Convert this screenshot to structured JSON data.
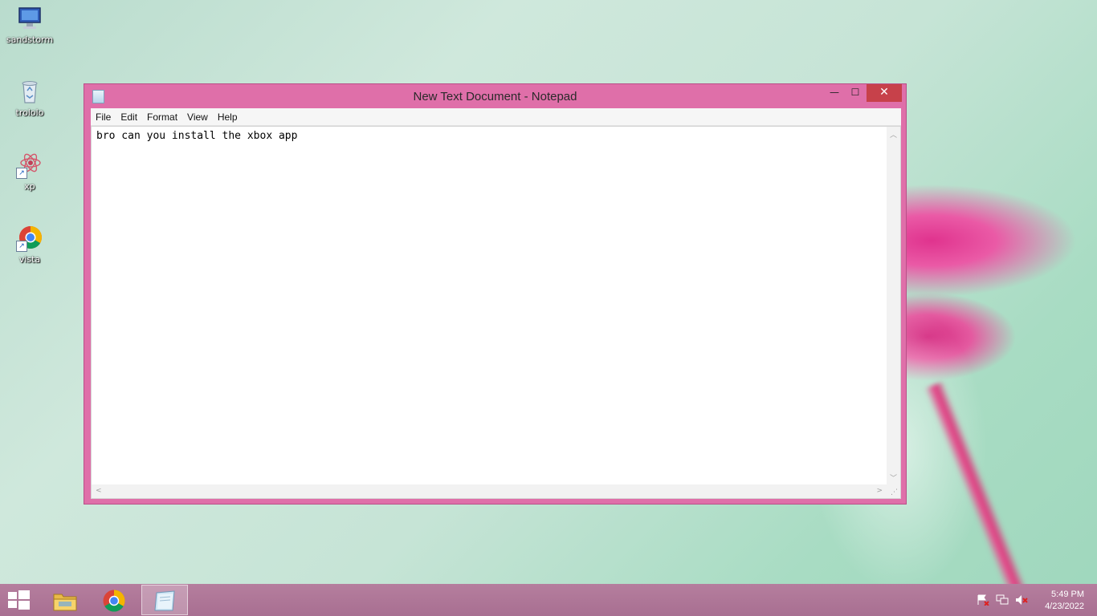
{
  "desktop": {
    "icons": [
      {
        "label": "sandstorm",
        "icon": "computer-icon"
      },
      {
        "label": "trololo",
        "icon": "recycle-bin-icon"
      },
      {
        "label": "xp",
        "icon": "flower-shortcut-icon"
      },
      {
        "label": "vista",
        "icon": "chrome-shortcut-icon"
      }
    ]
  },
  "window": {
    "title": "New Text Document - Notepad",
    "minimize_glyph": "—",
    "maximize_glyph": "☐",
    "close_glyph": "✕",
    "menu": [
      "File",
      "Edit",
      "Format",
      "View",
      "Help"
    ],
    "content": "bro can you install the xbox app"
  },
  "taskbar": {
    "apps": [
      {
        "name": "file-explorer",
        "icon": "folder-icon",
        "active": false
      },
      {
        "name": "chrome",
        "icon": "chrome-icon",
        "active": false
      },
      {
        "name": "notepad",
        "icon": "notepad-icon",
        "active": true
      }
    ],
    "time": "5:49 PM",
    "date": "4/23/2022"
  }
}
